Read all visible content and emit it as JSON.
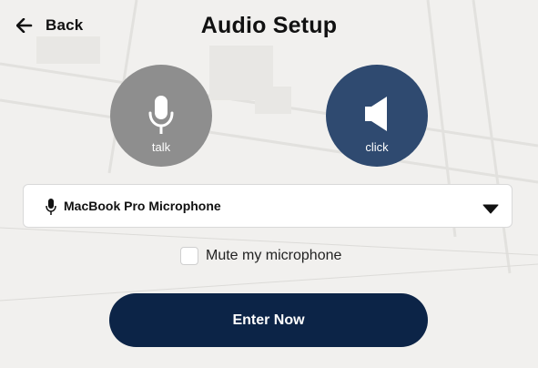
{
  "header": {
    "back_label": "Back",
    "title": "Audio Setup"
  },
  "modes": {
    "talk": {
      "label": "talk",
      "icon": "microphone-icon",
      "color": "#8e8e8e"
    },
    "click": {
      "label": "click",
      "icon": "speaker-icon",
      "color": "#2f4a70",
      "selected": true
    }
  },
  "microphone_select": {
    "value": "MacBook Pro Microphone",
    "icon": "microphone-icon"
  },
  "mute": {
    "label": "Mute my microphone",
    "checked": false
  },
  "enter_button": {
    "label": "Enter Now",
    "color": "#0c2447"
  }
}
